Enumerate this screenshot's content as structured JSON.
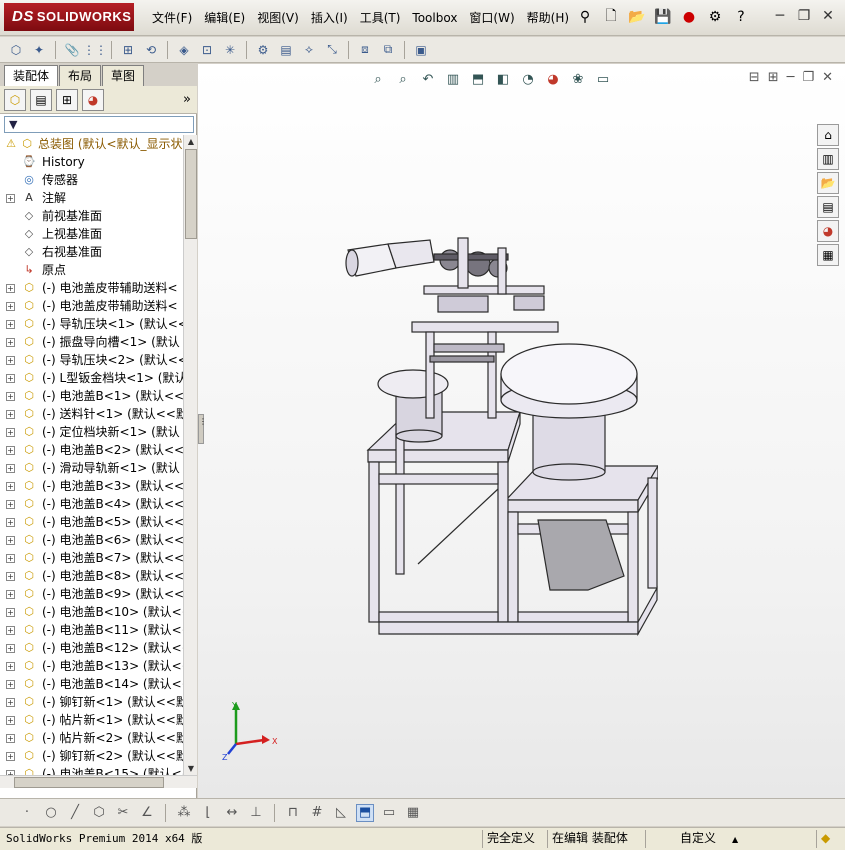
{
  "titlebar": {
    "logo": "SOLIDWORKS",
    "logo_mark": "DS",
    "menus": [
      "文件(F)",
      "编辑(E)",
      "视图(V)",
      "插入(I)",
      "工具(T)",
      "Toolbox",
      "窗口(W)",
      "帮助(H)"
    ]
  },
  "left_pane": {
    "tabs": [
      "装配体",
      "布局",
      "草图"
    ],
    "more": "»",
    "tree": [
      {
        "label": "总装图  (默认<默认_显示状",
        "icon": "assembly-warning-icon",
        "expand": "",
        "indent": 0,
        "color": "#8a5a00"
      },
      {
        "label": "History",
        "icon": "history-icon",
        "expand": "",
        "indent": 1
      },
      {
        "label": "传感器",
        "icon": "sensor-icon",
        "expand": "",
        "indent": 1
      },
      {
        "label": "注解",
        "icon": "annotation-icon",
        "expand": "+",
        "indent": 1
      },
      {
        "label": "前视基准面",
        "icon": "plane-icon",
        "expand": "",
        "indent": 1
      },
      {
        "label": "上视基准面",
        "icon": "plane-icon",
        "expand": "",
        "indent": 1
      },
      {
        "label": "右视基准面",
        "icon": "plane-icon",
        "expand": "",
        "indent": 1
      },
      {
        "label": "原点",
        "icon": "origin-icon",
        "expand": "",
        "indent": 1
      },
      {
        "label": "(-) 电池盖皮带辅助送料<",
        "icon": "part-icon",
        "expand": "+",
        "indent": 1
      },
      {
        "label": "(-) 电池盖皮带辅助送料<",
        "icon": "part-icon",
        "expand": "+",
        "indent": 1
      },
      {
        "label": "(-) 导轨压块<1> (默认<<",
        "icon": "part-icon",
        "expand": "+",
        "indent": 1
      },
      {
        "label": "(-) 振盘导向槽<1> (默认",
        "icon": "part-icon",
        "expand": "+",
        "indent": 1
      },
      {
        "label": "(-) 导轨压块<2> (默认<<",
        "icon": "part-icon",
        "expand": "+",
        "indent": 1
      },
      {
        "label": "(-) L型钣金档块<1> (默认",
        "icon": "part-icon",
        "expand": "+",
        "indent": 1
      },
      {
        "label": "(-) 电池盖B<1> (默认<<默",
        "icon": "part-icon",
        "expand": "+",
        "indent": 1
      },
      {
        "label": "(-) 送料针<1> (默认<<默",
        "icon": "part-icon",
        "expand": "+",
        "indent": 1
      },
      {
        "label": "(-) 定位档块新<1> (默认",
        "icon": "part-icon",
        "expand": "+",
        "indent": 1
      },
      {
        "label": "(-) 电池盖B<2> (默认<<默",
        "icon": "part-icon",
        "expand": "+",
        "indent": 1
      },
      {
        "label": "(-) 滑动导轨新<1> (默认",
        "icon": "part-icon",
        "expand": "+",
        "indent": 1
      },
      {
        "label": "(-) 电池盖B<3> (默认<<默",
        "icon": "part-icon",
        "expand": "+",
        "indent": 1
      },
      {
        "label": "(-) 电池盖B<4> (默认<<默",
        "icon": "part-icon",
        "expand": "+",
        "indent": 1
      },
      {
        "label": "(-) 电池盖B<5> (默认<<默",
        "icon": "part-icon",
        "expand": "+",
        "indent": 1
      },
      {
        "label": "(-) 电池盖B<6> (默认<<默",
        "icon": "part-icon",
        "expand": "+",
        "indent": 1
      },
      {
        "label": "(-) 电池盖B<7> (默认<<默",
        "icon": "part-icon",
        "expand": "+",
        "indent": 1
      },
      {
        "label": "(-) 电池盖B<8> (默认<<默",
        "icon": "part-icon",
        "expand": "+",
        "indent": 1
      },
      {
        "label": "(-) 电池盖B<9> (默认<<默",
        "icon": "part-icon",
        "expand": "+",
        "indent": 1
      },
      {
        "label": "(-) 电池盖B<10> (默认<<",
        "icon": "part-icon",
        "expand": "+",
        "indent": 1
      },
      {
        "label": "(-) 电池盖B<11> (默认<<",
        "icon": "part-icon",
        "expand": "+",
        "indent": 1
      },
      {
        "label": "(-) 电池盖B<12> (默认<<",
        "icon": "part-icon",
        "expand": "+",
        "indent": 1
      },
      {
        "label": "(-) 电池盖B<13> (默认<<",
        "icon": "part-icon",
        "expand": "+",
        "indent": 1
      },
      {
        "label": "(-) 电池盖B<14> (默认<<",
        "icon": "part-icon",
        "expand": "+",
        "indent": 1
      },
      {
        "label": "(-) 铆钉新<1> (默认<<默",
        "icon": "part-icon",
        "expand": "+",
        "indent": 1
      },
      {
        "label": "(-) 帖片新<1> (默认<<默",
        "icon": "part-icon",
        "expand": "+",
        "indent": 1
      },
      {
        "label": "(-) 帖片新<2> (默认<<默",
        "icon": "part-icon",
        "expand": "+",
        "indent": 1
      },
      {
        "label": "(-) 铆钉新<2> (默认<<默",
        "icon": "part-icon",
        "expand": "+",
        "indent": 1
      },
      {
        "label": "(-) 电池盖B<15> (默认<<",
        "icon": "part-icon",
        "expand": "+",
        "indent": 1
      }
    ]
  },
  "viewport": {
    "triad": {
      "x": "X",
      "y": "Y",
      "z": "Z"
    }
  },
  "statusbar": {
    "product": "SolidWorks Premium 2014 x64 版",
    "state": "完全定义",
    "mode": "在编辑 装配体",
    "units": "自定义",
    "units_arrow": "▲"
  }
}
